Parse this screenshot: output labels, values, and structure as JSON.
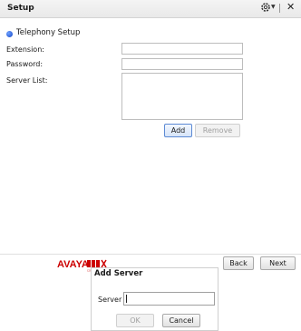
{
  "window": {
    "title": "Setup"
  },
  "section": {
    "label": "Telephony Setup"
  },
  "fields": {
    "extension_label": "Extension:",
    "extension_value": "",
    "password_label": "Password:",
    "password_value": "",
    "server_list_label": "Server List:",
    "server_list_items": []
  },
  "buttons": {
    "add": "Add",
    "remove": "Remove",
    "back": "Back",
    "next": "Next"
  },
  "brand": {
    "logo_text": "AVAYA one-X COMMUNICATOR",
    "accent": "#cc0000"
  },
  "dialog": {
    "title": "Add Server",
    "server_label": "Server",
    "server_value": "",
    "ok": "OK",
    "cancel": "Cancel"
  },
  "icons": {
    "settings": "gear-icon",
    "close": "close-icon",
    "section": "radio-bullet-icon"
  }
}
